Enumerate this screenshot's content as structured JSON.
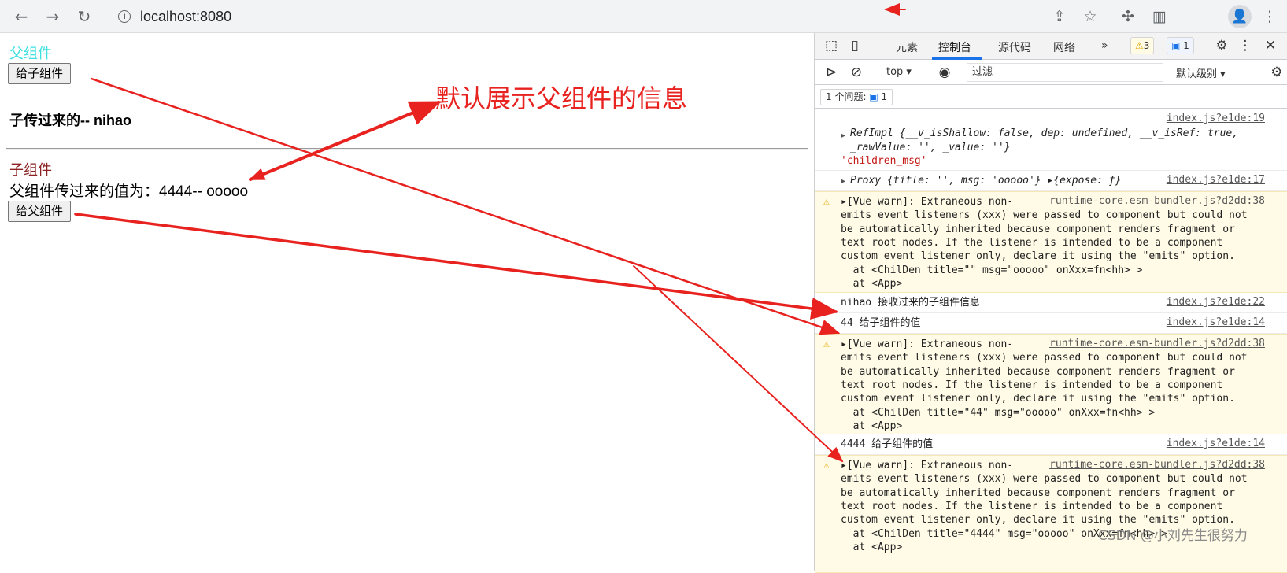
{
  "browser": {
    "url": "localhost:8080",
    "back_icon": "arrow-left-icon",
    "forward_icon": "arrow-right-icon",
    "reload_icon": "reload-icon"
  },
  "page": {
    "parent_title": "父组件",
    "give_child_button": "给子组件",
    "child_message": "子传过来的-- nihao",
    "child_title": "子组件",
    "child_value_text": "父组件传过来的值为：4444-- ooooo",
    "give_parent_button": "给父组件",
    "annotation": "默认展示父组件的信息"
  },
  "devtools": {
    "tabs": [
      "元素",
      "控制台",
      "源代码",
      "网络"
    ],
    "active_tab": "控制台",
    "more": "»",
    "warn_count": "3",
    "info_count": "1",
    "context": "top ▾",
    "filter_placeholder": "过滤",
    "level": "默认级别 ▾",
    "issues_label": "1 个问题:",
    "issues_count": "1"
  },
  "console": {
    "m1_src": "index.js?e1de:19",
    "m1_l1": "RefImpl {__v_isShallow: false, dep: undefined, __v_isRef: true,",
    "m1_l2": "_rawValue: '', _value: ''}",
    "m1_l3": "'children_msg'",
    "m2_src": "index.js?e1de:17",
    "m2_l1": "Proxy {title: '', msg: 'ooooo'} ▸{expose: ƒ}",
    "w_src": "runtime-core.esm-bundler.js?d2dd:38",
    "w_l1": "▸[Vue warn]: Extraneous non-",
    "w_l2": "emits event listeners (xxx) were passed to component but could not",
    "w_l3": "be automatically inherited because component renders fragment or",
    "w_l4": "text root nodes. If the listener is intended to be a component",
    "w_l5": "custom event listener only, declare it using the \"emits\" option.",
    "w_app": "  at <App>",
    "w1_at": "  at <ChilDen title=\"\" msg=\"ooooo\" onXxx=fn<hh> >",
    "w2_at": "  at <ChilDen title=\"44\" msg=\"ooooo\" onXxx=fn<hh> >",
    "w3_at": "  at <ChilDen title=\"4444\" msg=\"ooooo\" onXxx=fn<hh> >",
    "m3_text": "nihao 接收过来的子组件信息",
    "m3_src": "index.js?e1de:22",
    "m4_text": "44 给子组件的值",
    "m4_src": "index.js?e1de:14",
    "m5_text": "4444 给子组件的值",
    "m5_src": "index.js?e1de:14"
  },
  "watermark": "CSDN @小刘先生很努力",
  "colors": {
    "arrow": "#e8221f",
    "parent_title": "#40e0e0",
    "child_title": "#8b2323"
  }
}
